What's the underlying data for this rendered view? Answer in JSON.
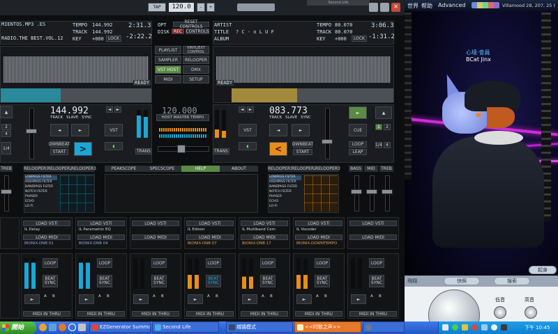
{
  "topbar": {
    "tap_label": "TAP",
    "tempo_display": "120.0",
    "minus": "-",
    "plus": "+",
    "window_title": "Second Life",
    "top_tab_right": "Second Life"
  },
  "deck_a": {
    "filename": "MIENTOS.MP3 .ES",
    "title_line": "RADIO.THE BEST.VOL.12",
    "tempo_label": "TEMPO",
    "tempo_value": "144.992",
    "track_label": "TRACK",
    "track_value": "144.992",
    "key_label": "KEY",
    "key_value": "+000",
    "lock_label": "LOCK",
    "time_elapsed": "2:31.3",
    "time_remain": "-2:22.2",
    "ready": "READY",
    "bpm_big": "144.992",
    "track_slave_sync": [
      "TRACK",
      "SLAVE",
      "SYNC"
    ],
    "vst": "VST",
    "dwnbeat": "DWNBEAT",
    "start": "START",
    "trans": "TRANS",
    "pitch_nums": [
      "2",
      "4",
      "1/4"
    ]
  },
  "deck_b": {
    "artist_label": "ARTIST",
    "title_label": "TITLE",
    "title_value": "? C - o L U F",
    "album_label": "ALBUM",
    "tempo_label": "TEMPO",
    "tempo_value": "80.070",
    "track_label": "TRACK",
    "track_value": "80.070",
    "key_label": "KEY",
    "key_value": "+000",
    "lock_label": "LOCK",
    "time_elapsed": "3:06.3",
    "time_remain": "-1:31.2",
    "ready": "READY",
    "bpm_big": "083.773",
    "track_slave_sync": [
      "TRACK",
      "SLAVE",
      "SYNC"
    ],
    "vst": "VST",
    "cue": "CUE",
    "dwnbeat": "DWNBEAT",
    "start": "START",
    "loop": "LOOP",
    "leap": "LEAP",
    "trans": "TRANS",
    "pitch_nums": [
      "1",
      "2",
      "1/4",
      "4"
    ]
  },
  "center": {
    "opt": "OPT",
    "disk": "DISK",
    "rec": "REC",
    "reset_controls": "RESET CONTROLS",
    "controls": "CONTROLS",
    "menu": [
      "PLAYLIST",
      "VINYL/EXT CONTROL",
      "SAMPLER",
      "RELOOPER",
      "VST HOST",
      "DMX",
      "MIDI",
      "SETUP"
    ],
    "master_tempo_display": "120.000",
    "host_master_tempo": "HOST MASTER TEMPO"
  },
  "lower_tabs": {
    "left": [
      "RELOOPER1",
      "RELOOPER2",
      "RELOOPER3"
    ],
    "left_eq": "TREB",
    "center": [
      "PEAKSCOPE",
      "SPECSCOPE",
      "HELP",
      "ABOUT"
    ],
    "right": [
      "RELOOPER1",
      "RELOOPER2",
      "RELOOPER3"
    ],
    "right_eq": [
      "BASS",
      "MID",
      "TREB"
    ]
  },
  "filter_list": [
    "LOWPASS FILTER",
    "HIGHPASS FILTER",
    "BANDPASS FILTER",
    "NOTCH FILTER",
    "PHASER",
    "ECHO",
    "LO-FI"
  ],
  "vst_slots": [
    {
      "load": "LOAD VSTi",
      "plugin": "IL Delay",
      "midi": "LOAD MIDI",
      "preset": "BIONIX-DNB 01"
    },
    {
      "load": "LOAD VSTi",
      "plugin": "IL Parametric EQ",
      "midi": "LOAD MIDI",
      "preset": "BIONIX-DNB 04"
    },
    {
      "load": "LOAD VSTi",
      "plugin": "",
      "midi": "LOAD MIDI",
      "preset": ""
    },
    {
      "load": "LOAD VSTi",
      "plugin": "IL Edison",
      "midi": "LOAD MIDI",
      "preset": "BIONIX-DNB 07"
    },
    {
      "load": "LOAD VSTi",
      "plugin": "IL Multiband Com",
      "midi": "LOAD MIDI",
      "preset": "BIONIX-DNB 17"
    },
    {
      "load": "LOAD VSTi",
      "plugin": "IL Vocoder",
      "midi": "LOAD MIDI",
      "preset": "BIONIX-DOWNTEMPO"
    },
    {
      "load": "LOAD VSTi",
      "plugin": "",
      "midi": "LOAD MIDI",
      "preset": ""
    }
  ],
  "sampler": {
    "loop": "LOOP",
    "beat": "BEAT",
    "sync": "SYNC",
    "a": "A",
    "b": "B",
    "midi_in_thru": "MIDI IN THRU"
  },
  "secondlife": {
    "menu": [
      "世界",
      "帮助",
      "Advanced"
    ],
    "location": "Villamood 28, 207, 25 (",
    "avatar_name_cn": "心境·會員",
    "avatar_name": "BCat Jinx",
    "bottom_left_label": "飛翔",
    "bottom_buttons": [
      "快照",
      "搜索"
    ],
    "top_right_btn": "起身",
    "bass_label": "低音",
    "treble_label": "高音"
  },
  "taskbar": {
    "start": "開始",
    "items": [
      "EZGenerator Summa...",
      "Second Life",
      "城镇模式",
      "<<时歌之声>>"
    ],
    "clock": "下午 10:45"
  },
  "colors": {
    "blue_accent": "#1aa7d6",
    "orange_accent": "#e88d1a",
    "green_accent": "#5b8a45",
    "taskbar": "#2458c4",
    "start_green": "#3c9a32"
  }
}
